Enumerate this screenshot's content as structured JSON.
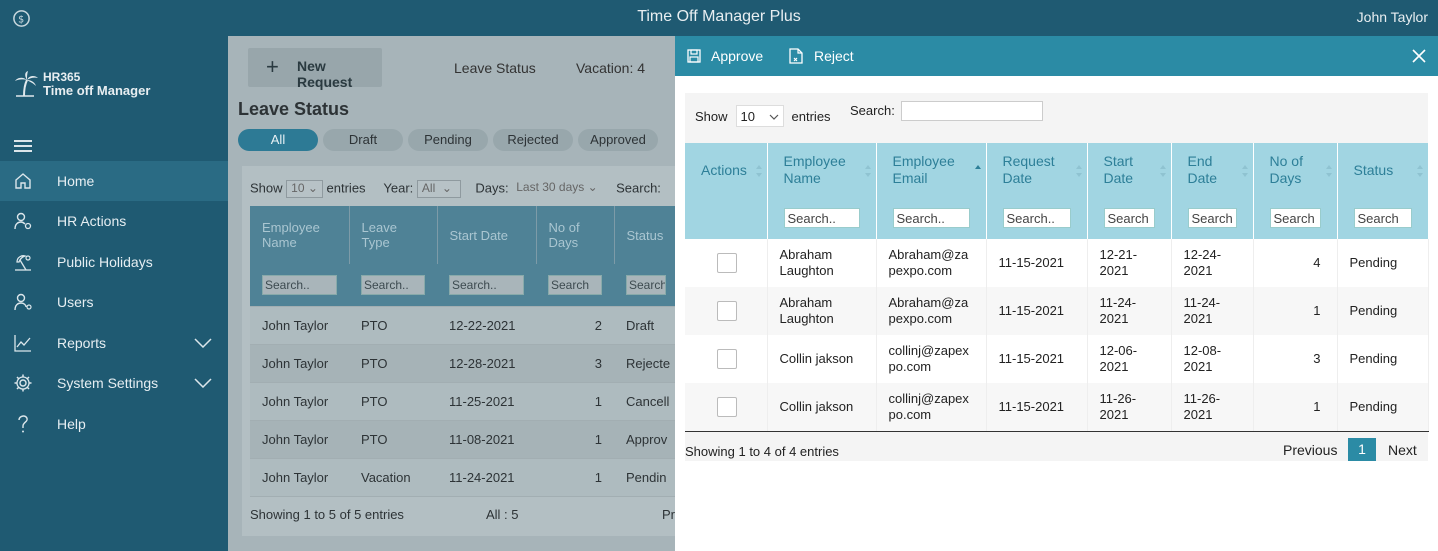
{
  "topbar": {
    "title": "Time Off Manager Plus",
    "user": "John Taylor"
  },
  "brand": {
    "line1": "HR365",
    "line2": "Time off Manager"
  },
  "sidebar": {
    "items": [
      {
        "label": "Home",
        "icon": "home-icon"
      },
      {
        "label": "HR Actions",
        "icon": "person-gear-icon"
      },
      {
        "label": "Public Holidays",
        "icon": "beach-icon"
      },
      {
        "label": "Users",
        "icon": "users-icon"
      },
      {
        "label": "Reports",
        "icon": "chart-line-icon"
      },
      {
        "label": "System Settings",
        "icon": "gear-icon"
      },
      {
        "label": "Help",
        "icon": "question-icon"
      }
    ]
  },
  "background": {
    "new_request": "New Request",
    "tabs": [
      "Leave Status",
      "Vacation: 4"
    ],
    "title": "Leave Status",
    "pills": [
      "All",
      "Draft",
      "Pending",
      "Rejected",
      "Approved"
    ],
    "filters": {
      "show": "Show",
      "show_value": "10",
      "entries": "entries",
      "year": "Year:",
      "year_value": "All",
      "days": "Days:",
      "days_value": "Last 30 days",
      "search": "Search:"
    },
    "columns": [
      "Employee Name",
      "Leave Type",
      "Start Date",
      "No of Days",
      "Status"
    ],
    "search_placeholders": [
      "Search..",
      "Search..",
      "Search..",
      "Search",
      "Search"
    ],
    "rows": [
      {
        "name": "John Taylor",
        "type": "PTO",
        "start": "12-22-2021",
        "days": "2",
        "status": "Draft"
      },
      {
        "name": "John Taylor",
        "type": "PTO",
        "start": "12-28-2021",
        "days": "3",
        "status": "Rejecte"
      },
      {
        "name": "John Taylor",
        "type": "PTO",
        "start": "11-25-2021",
        "days": "1",
        "status": "Cancell"
      },
      {
        "name": "John Taylor",
        "type": "PTO",
        "start": "11-08-2021",
        "days": "1",
        "status": "Approv"
      },
      {
        "name": "John Taylor",
        "type": "Vacation",
        "start": "11-24-2021",
        "days": "1",
        "status": "Pendin"
      }
    ],
    "footer": "Showing 1 to 5 of 5 entries",
    "all_count": "All : 5",
    "pr": "Pr"
  },
  "panel": {
    "approve": "Approve",
    "reject": "Reject",
    "show": "Show",
    "show_value": "10",
    "entries": "entries",
    "search_label": "Search:",
    "columns": [
      "Actions",
      "Employee Name",
      "Employee Email",
      "Request Date",
      "Start Date",
      "End Date",
      "No of Days",
      "Status"
    ],
    "filter_placeholders": [
      "Search..",
      "Search..",
      "Search..",
      "Search",
      "Search",
      "Search",
      "Search"
    ],
    "rows": [
      {
        "name": "Abraham Laughton",
        "email": "Abraham@zapexpo.com",
        "request": "11-15-2021",
        "start": "12-21-2021",
        "end": "12-24-2021",
        "days": "4",
        "status": "Pending"
      },
      {
        "name": "Abraham Laughton",
        "email": "Abraham@zapexpo.com",
        "request": "11-15-2021",
        "start": "11-24-2021",
        "end": "11-24-2021",
        "days": "1",
        "status": "Pending"
      },
      {
        "name": "Collin jakson",
        "email": "collinj@zapexpo.com",
        "request": "11-15-2021",
        "start": "12-06-2021",
        "end": "12-08-2021",
        "days": "3",
        "status": "Pending"
      },
      {
        "name": "Collin jakson",
        "email": "collinj@zapexpo.com",
        "request": "11-15-2021",
        "start": "11-26-2021",
        "end": "11-26-2021",
        "days": "1",
        "status": "Pending"
      }
    ],
    "info": "Showing 1 to 4 of 4 entries",
    "prev": "Previous",
    "page": "1",
    "next": "Next"
  },
  "colors": {
    "primary": "#1f5a72",
    "accent": "#2b8ba5",
    "header_light": "#a1d5e2"
  }
}
